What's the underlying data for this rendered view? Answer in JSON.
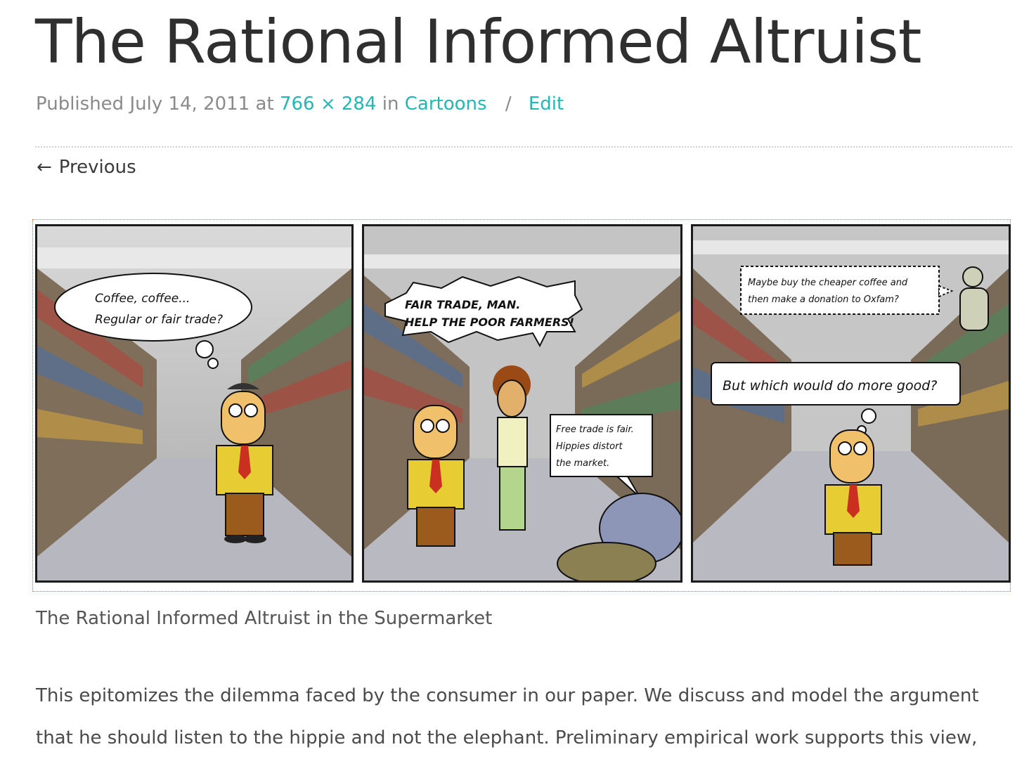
{
  "title": "The Rational Informed Altruist",
  "meta": {
    "published_prefix": "Published",
    "date": "July 14, 2011",
    "at": "at",
    "dimensions": "766 × 284",
    "in": "in",
    "category": "Cartoons",
    "separator": "/",
    "edit": "Edit"
  },
  "nav": {
    "previous_arrow": "←",
    "previous_label": "Previous"
  },
  "comic": {
    "panel1": {
      "thought_line1": "Coffee, coffee...",
      "thought_line2": "Regular or fair trade?"
    },
    "panel2": {
      "shout_line1": "FAIR TRADE, MAN.",
      "shout_line2": "HELP THE POOR FARMERS!",
      "elephant_line1": "Free trade is fair.",
      "elephant_line2": "Hippies distort",
      "elephant_line3": "the market."
    },
    "panel3": {
      "whisper_line1": "Maybe buy the cheaper coffee and",
      "whisper_line2": "then make a donation to Oxfam?",
      "question": "But which would do more good?"
    }
  },
  "caption": "The Rational Informed Altruist in the Supermarket",
  "body": {
    "paragraph": "This epitomizes the dilemma faced by the consumer in our paper. We discuss and model the argument that he should listen to the hippie and not the elephant. Preliminary empirical work supports this view,"
  },
  "colors": {
    "link": "#22b7b5",
    "comic_border": "#e06a35",
    "title": "#2f2f2f",
    "meta": "#8a8a8a"
  }
}
